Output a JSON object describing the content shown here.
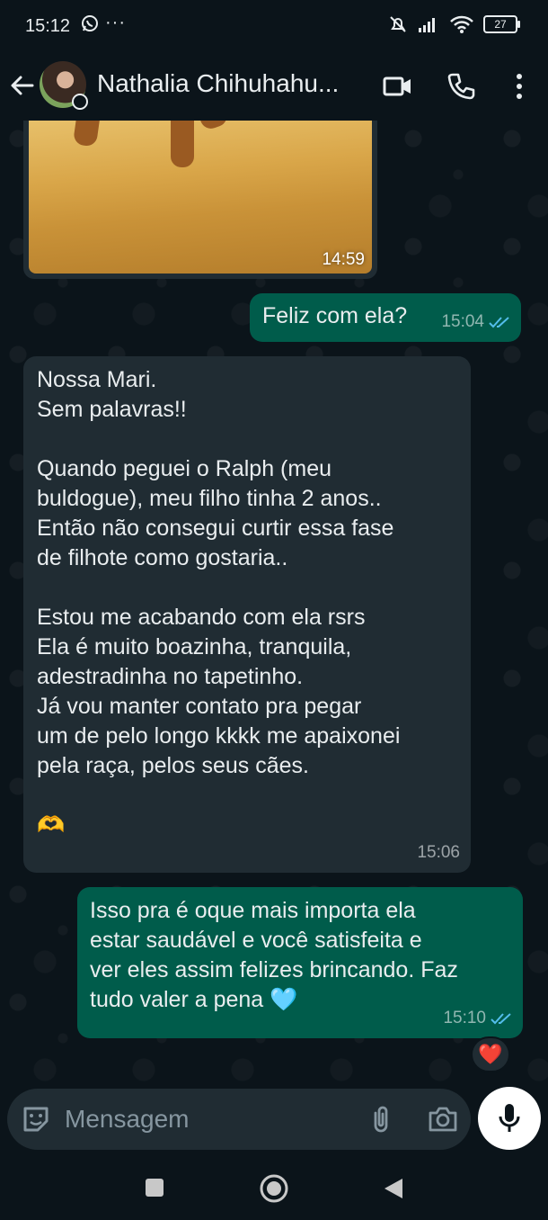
{
  "status_bar": {
    "time": "15:12",
    "more": "···",
    "battery": "27"
  },
  "header": {
    "contact_name": "Nathalia Chihuhahu..."
  },
  "messages": [
    {
      "type": "image",
      "direction": "incoming",
      "time": "14:59"
    },
    {
      "type": "text",
      "direction": "outgoing",
      "text": "Feliz com ela?",
      "time": "15:04",
      "read": true
    },
    {
      "type": "text",
      "direction": "incoming",
      "text": "Nossa Mari.\nSem palavras!!\n\nQuando peguei o Ralph (meu\nbuldogue), meu filho tinha 2 anos..\nEntão não consegui curtir essa fase\nde filhote como gostaria..\n\nEstou me acabando com ela rsrs\nEla é muito boazinha, tranquila,\nadestradinha no tapetinho.\nJá vou manter contato pra pegar\num de pelo longo kkkk me apaixonei\npela raça, pelos seus cães.\n\n🫶",
      "time": "15:06"
    },
    {
      "type": "text",
      "direction": "outgoing",
      "text": "Isso pra é oque mais importa ela\nestar saudável e você satisfeita e\nver eles assim felizes brincando. Faz\ntudo valer a pena 🩵",
      "time": "15:10",
      "read": true,
      "reaction": "❤️"
    }
  ],
  "composer": {
    "placeholder": "Mensagem"
  },
  "colors": {
    "background": "#0b141a",
    "incoming_bubble": "#202c33",
    "outgoing_bubble": "#005c4b",
    "read_ticks": "#53bdeb"
  }
}
